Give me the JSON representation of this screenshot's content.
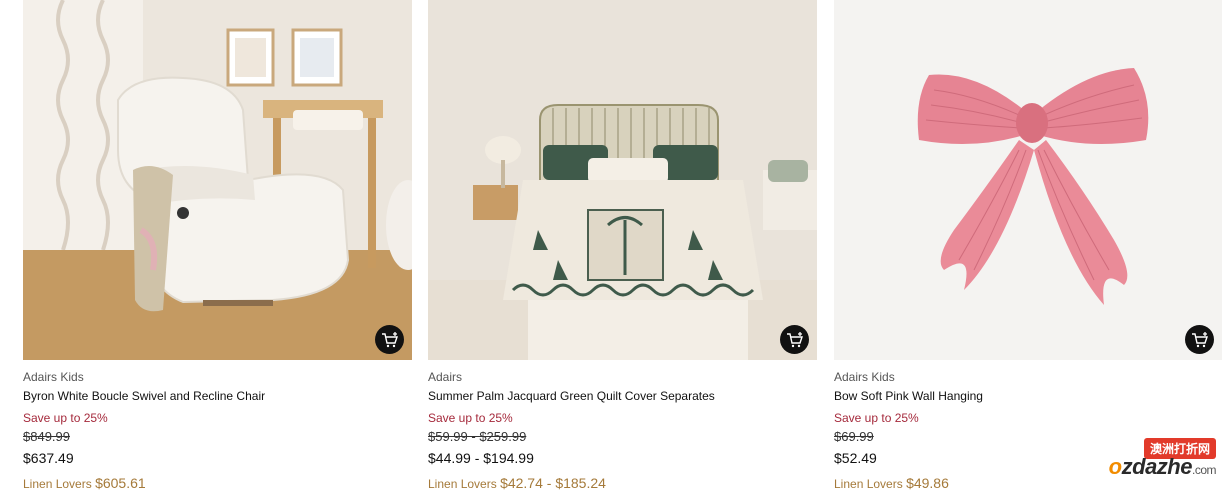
{
  "products": [
    {
      "brand": "Adairs Kids",
      "title": "Byron White Boucle Swivel and Recline Chair",
      "save": "Save up to 25%",
      "was": "$849.99",
      "now": "$637.49",
      "member_label": "Linen Lovers",
      "member_price": "$605.61",
      "image_icon": "chair-photo"
    },
    {
      "brand": "Adairs",
      "title": "Summer Palm Jacquard Green Quilt Cover Separates",
      "save": "Save up to 25%",
      "was": "$59.99 - $259.99",
      "now": "$44.99 - $194.99",
      "member_label": "Linen Lovers",
      "member_price": "$42.74 - $185.24",
      "image_icon": "bed-photo"
    },
    {
      "brand": "Adairs Kids",
      "title": "Bow Soft Pink Wall Hanging",
      "save": "Save up to 25%",
      "was": "$69.99",
      "now": "$52.49",
      "member_label": "Linen Lovers",
      "member_price": "$49.86",
      "image_icon": "bow-photo"
    }
  ],
  "watermark": {
    "top": "澳洲打折网",
    "main_o": "o",
    "main_rest": "zdazhe",
    "suffix": ".com"
  },
  "colors": {
    "save": "#a52a3c",
    "member": "#a57a3a",
    "cart_button": "#111111"
  }
}
